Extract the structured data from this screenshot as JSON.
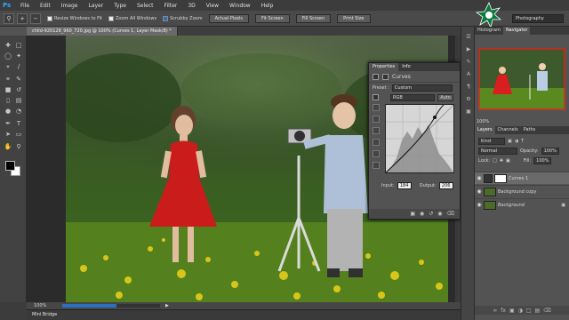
{
  "app": {
    "logo": "Ps"
  },
  "menu": [
    "File",
    "Edit",
    "Image",
    "Layer",
    "Type",
    "Select",
    "Filter",
    "3D",
    "View",
    "Window",
    "Help"
  ],
  "options": {
    "resize_windows": "Resize Windows to Fit",
    "zoom_all": "Zoom All Windows",
    "scrubby_zoom": "Scrubby Zoom",
    "actual_pixels": "Actual Pixels",
    "fit_screen": "Fit Screen",
    "fill_screen": "Fill Screen",
    "print_size": "Print Size",
    "workspace": "Photography"
  },
  "document": {
    "tab_title": "child-920128_960_720.jpg @ 100% (Curves 1, Layer Mask/8) *",
    "zoom": "100%",
    "progress_fraction": 0.55
  },
  "properties": {
    "tab_properties": "Properties",
    "tab_info": "Info",
    "adjustment": "Curves",
    "preset_label": "Preset :",
    "preset_value": "Custom",
    "channel_value": "RGB",
    "auto_label": "Auto",
    "input_label": "Input:",
    "input_value": "184",
    "output_label": "Output:",
    "output_value": "206"
  },
  "dock": {
    "histogram_tab": "Histogram",
    "navigator_tab": "Navigator",
    "nav_zoom": "100%",
    "layers_tab": "Layers",
    "channels_tab": "Channels",
    "paths_tab": "Paths",
    "kind_label": "Kind",
    "blend_mode": "Normal",
    "opacity_label": "Opacity:",
    "opacity_value": "100%",
    "lock_label": "Lock:",
    "fill_label": "Fill:",
    "fill_value": "100%",
    "layers": [
      {
        "name": "Curves 1",
        "selected": true
      },
      {
        "name": "Background copy",
        "selected": false
      },
      {
        "name": "Background",
        "selected": false
      }
    ]
  },
  "bottom": {
    "mini_bridge": "Mini Bridge"
  },
  "colors": {
    "accent": "#2d6fbe",
    "panel": "#535353",
    "menubar": "#3c3c3c"
  },
  "icons": [
    "zoom-icon",
    "zoom-in-icon",
    "zoom-out-icon",
    "move-icon",
    "marquee-icon",
    "lasso-icon",
    "quick-select-icon",
    "crop-icon",
    "eyedropper-icon",
    "healing-brush-icon",
    "brush-icon",
    "clone-stamp-icon",
    "history-brush-icon",
    "eraser-icon",
    "gradient-icon",
    "blur-icon",
    "dodge-icon",
    "pen-icon",
    "type-icon",
    "path-select-icon",
    "shape-icon",
    "hand-icon",
    "zoom-tool-icon",
    "eye-icon",
    "trash-icon"
  ]
}
